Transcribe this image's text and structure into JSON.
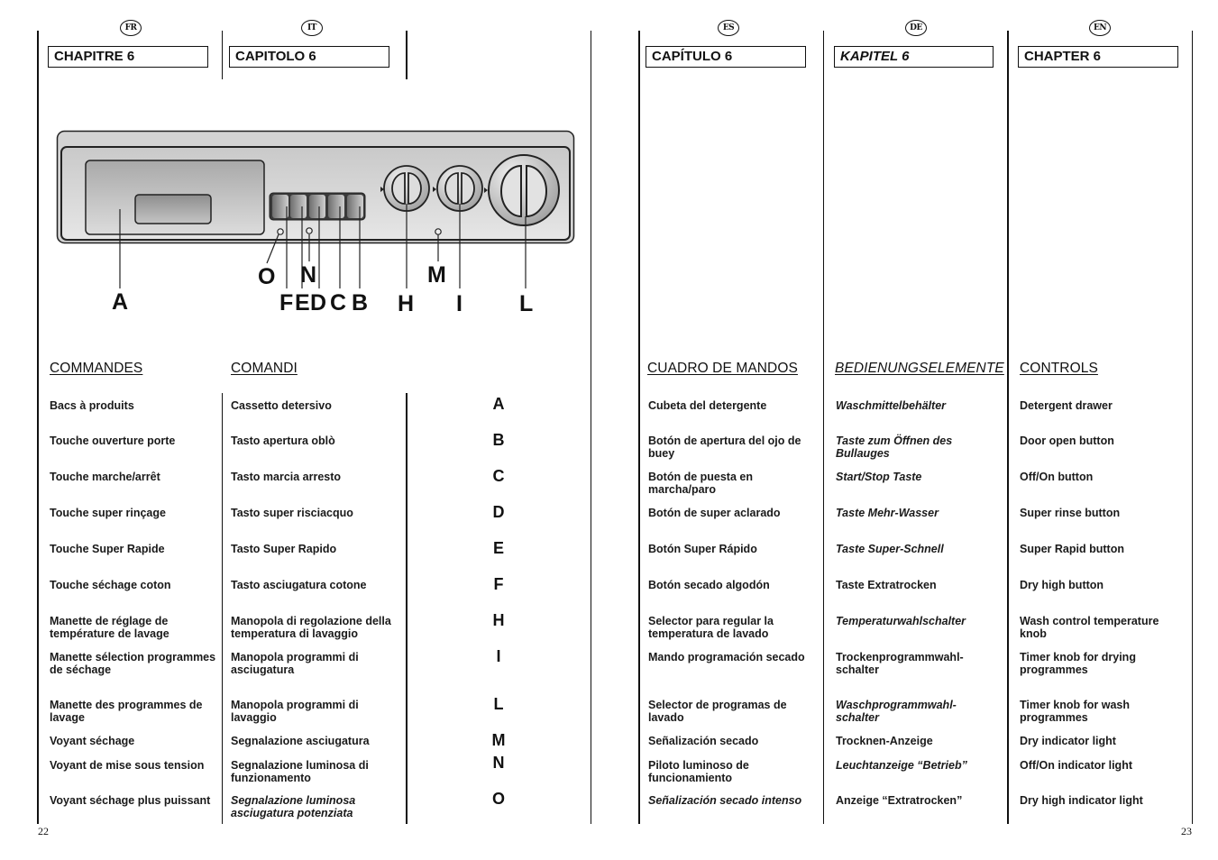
{
  "columns": [
    {
      "lang": "FR",
      "chapter": "CHAPITRE 6",
      "section": "COMMANDES",
      "items": [
        "Bacs à produits",
        "Touche ouverture porte",
        "Touche marche/arrêt",
        "Touche super rinçage",
        "Touche Super Rapide",
        "Touche séchage coton",
        "Manette de réglage de température de lavage",
        "Manette sélection programmes de séchage",
        "Manette des programmes de lavage",
        "Voyant séchage",
        "Voyant de mise sous tension",
        "Voyant séchage plus puissant"
      ]
    },
    {
      "lang": "IT",
      "chapter": "CAPITOLO 6",
      "section": "COMANDI",
      "items": [
        "Cassetto detersivo",
        "Tasto apertura oblò",
        "Tasto marcia arresto",
        "Tasto super risciacquo",
        "Tasto Super Rapido",
        "Tasto asciugatura cotone",
        "Manopola di regolazione della temperatura di lavaggio",
        "Manopola programmi di asciugatura",
        "Manopola programmi di lavaggio",
        "Segnalazione asciugatura",
        "Segnalazione luminosa di funzionamento",
        "Segnalazione luminosa asciugatura potenziata"
      ]
    },
    {
      "lang": "ES",
      "chapter": "CAPÍTULO 6",
      "section": "CUADRO DE MANDOS",
      "items": [
        "Cubeta del detergente",
        "Botón de apertura del ojo de buey",
        "Botón de puesta en marcha/paro",
        "Botón de super aclarado",
        "Botón Super Rápido",
        "Botón secado algodón",
        "Selector para regular la temperatura de lavado",
        "Mando programación secado",
        "Selector de programas de lavado",
        "Señalización secado",
        "Piloto luminoso de funcionamiento",
        "Señalización secado intenso"
      ]
    },
    {
      "lang": "DE",
      "chapter": "KAPITEL 6",
      "section": "BEDIENUNGSELEMENTE",
      "items": [
        "Waschmittelbehälter",
        "Taste zum Öffnen des Bullauges",
        "Start/Stop Taste",
        "Taste Mehr-Wasser",
        "Taste Super-Schnell",
        "Taste Extratrocken",
        "Temperaturwahlschalter",
        "Trockenprogrammwahl-schalter",
        "Waschprogrammwahl-schalter",
        "Trocknen-Anzeige",
        "Leuchtanzeige “Betrieb”",
        "Anzeige “Extratrocken”"
      ]
    },
    {
      "lang": "EN",
      "chapter": "CHAPTER 6",
      "section": "CONTROLS",
      "items": [
        "Detergent drawer",
        "Door open button",
        "Off/On button",
        "Super rinse button",
        "Super Rapid button",
        "Dry high button",
        "Wash control temperature knob",
        "Timer knob for drying programmes",
        "Timer knob for wash programmes",
        "Dry indicator light",
        "Off/On indicator light",
        "Dry high indicator light"
      ]
    }
  ],
  "codes": [
    "A",
    "B",
    "C",
    "D",
    "E",
    "F",
    "H",
    "I",
    "L",
    "M",
    "N",
    "O"
  ],
  "diagram": {
    "labels": {
      "A": "A",
      "B": "B",
      "C": "C",
      "D": "D",
      "E": "E",
      "F": "F",
      "H": "H",
      "I": "I",
      "L": "L",
      "M": "M",
      "N": "N",
      "O": "O"
    }
  },
  "pages": {
    "left": "22",
    "right": "23"
  }
}
